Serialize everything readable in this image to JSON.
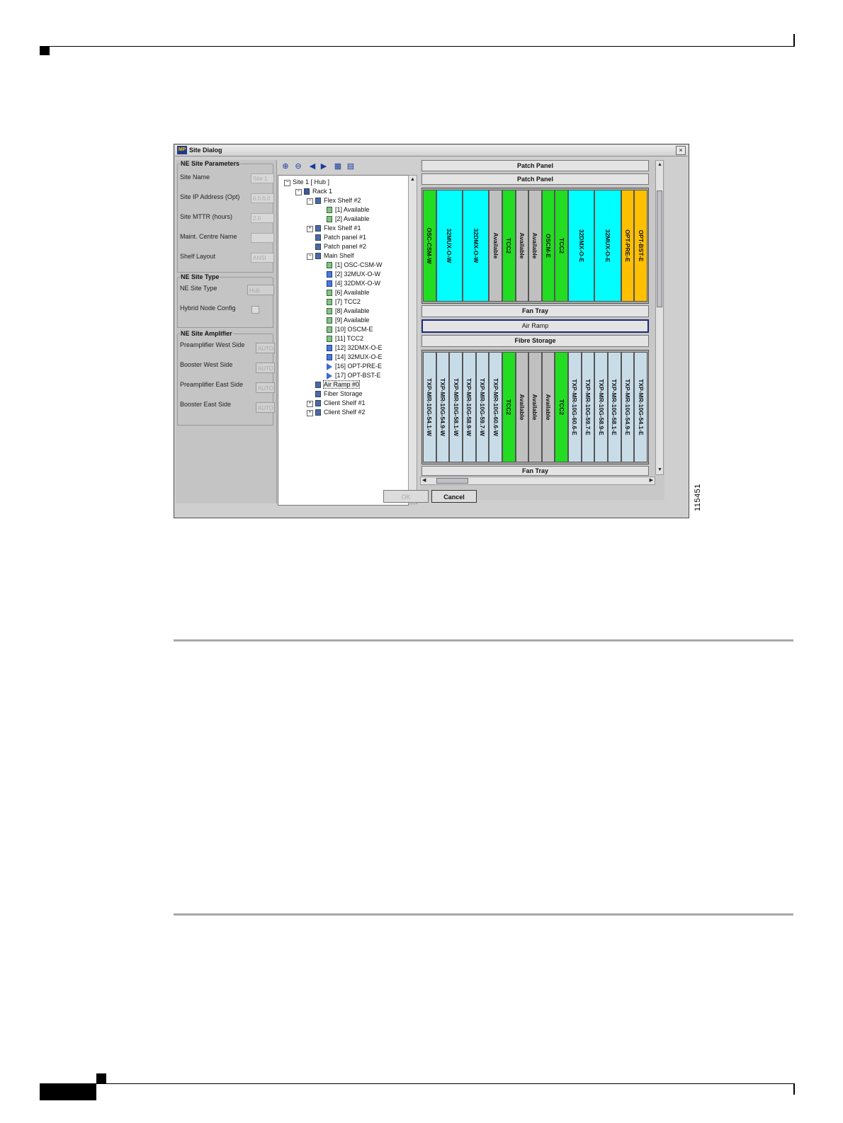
{
  "figure_id": "115451",
  "dialog": {
    "title": "Site Dialog",
    "close_label": "×",
    "left_panel": {
      "ne_site_parameters": {
        "title": "NE Site Parameters",
        "site_name_label": "Site Name",
        "site_name_value": "Site 1",
        "site_ip_label": "Site IP Address (Opt)",
        "site_ip_value": "0.0.0.0",
        "site_mttr_label": "Site MTTR (hours)",
        "site_mttr_value": "2.0",
        "maint_centre_label": "Maint. Centre Name",
        "maint_centre_value": "",
        "shelf_layout_label": "Shelf Layout",
        "shelf_layout_value": "ANSI"
      },
      "ne_site_type": {
        "title": "NE Site Type",
        "site_type_label": "NE Site Type",
        "site_type_value": "Hub",
        "hybrid_label": "Hybrid Node Config"
      },
      "ne_site_amplifier": {
        "title": "NE Site Amplifier",
        "pre_west_label": "Preamplifier West Side",
        "pre_west_value": "AUTO",
        "boost_west_label": "Booster West Side",
        "boost_west_value": "AUTO",
        "pre_east_label": "Preamplifier East Side",
        "pre_east_value": "AUTO",
        "boost_east_label": "Booster East Side",
        "boost_east_value": "AUTO"
      }
    },
    "tree": [
      {
        "label": "Site 1 [ Hub ]",
        "level": 0,
        "exp": "−",
        "icon": ""
      },
      {
        "label": "Rack 1",
        "level": 1,
        "exp": "−",
        "icon": "rack"
      },
      {
        "label": "Flex Shelf #2",
        "level": 2,
        "exp": "−",
        "icon": "shelf"
      },
      {
        "label": "[1] Available",
        "level": 3,
        "exp": "",
        "icon": "card"
      },
      {
        "label": "[2] Available",
        "level": 3,
        "exp": "",
        "icon": "card"
      },
      {
        "label": "Flex Shelf #1",
        "level": 2,
        "exp": "+",
        "icon": "shelf"
      },
      {
        "label": "Patch panel #1",
        "level": 2,
        "exp": "",
        "icon": "shelf"
      },
      {
        "label": "Patch panel #2",
        "level": 2,
        "exp": "",
        "icon": "shelf"
      },
      {
        "label": "Main Shelf",
        "level": 2,
        "exp": "−",
        "icon": "shelf"
      },
      {
        "label": "[1] OSC-CSM-W",
        "level": 3,
        "exp": "",
        "icon": "card"
      },
      {
        "label": "[2] 32MUX-O-W",
        "level": 3,
        "exp": "",
        "icon": "mux"
      },
      {
        "label": "[4] 32DMX-O-W",
        "level": 3,
        "exp": "",
        "icon": "mux"
      },
      {
        "label": "[6] Available",
        "level": 3,
        "exp": "",
        "icon": "card"
      },
      {
        "label": "[7] TCC2",
        "level": 3,
        "exp": "",
        "icon": "card"
      },
      {
        "label": "[8] Available",
        "level": 3,
        "exp": "",
        "icon": "card"
      },
      {
        "label": "[9] Available",
        "level": 3,
        "exp": "",
        "icon": "card"
      },
      {
        "label": "[10] OSCM-E",
        "level": 3,
        "exp": "",
        "icon": "card"
      },
      {
        "label": "[11] TCC2",
        "level": 3,
        "exp": "",
        "icon": "card"
      },
      {
        "label": "[12] 32DMX-O-E",
        "level": 3,
        "exp": "",
        "icon": "mux"
      },
      {
        "label": "[14] 32MUX-O-E",
        "level": 3,
        "exp": "",
        "icon": "mux"
      },
      {
        "label": "[16] OPT-PRE-E",
        "level": 3,
        "exp": "",
        "icon": "amp"
      },
      {
        "label": "[17] OPT-BST-E",
        "level": 3,
        "exp": "",
        "icon": "amp"
      },
      {
        "label": "Air Ramp #0",
        "level": 2,
        "exp": "",
        "icon": "shelf",
        "selected": true
      },
      {
        "label": "Fiber Storage",
        "level": 2,
        "exp": "",
        "icon": "shelf"
      },
      {
        "label": "Client Shelf #1",
        "level": 2,
        "exp": "+",
        "icon": "shelf"
      },
      {
        "label": "Client Shelf #2",
        "level": 2,
        "exp": "+",
        "icon": "shelf"
      }
    ],
    "rack": {
      "patch_panel_1": "Patch Panel",
      "patch_panel_2": "Patch Panel",
      "fan_tray_1": "Fan Tray",
      "air_ramp": "Air Ramp",
      "fibre_storage": "Fibre Storage",
      "fan_tray_2": "Fan Tray",
      "main_slots": [
        {
          "label": "OSC-CSM-W",
          "color": "#22dd22",
          "span": 1
        },
        {
          "label": "32MUX-O-W",
          "color": "#00ffff",
          "span": 2
        },
        {
          "label": "32DMX-O-W",
          "color": "#00ffff",
          "span": 2
        },
        {
          "label": "Available",
          "color": "#c0c0c0",
          "span": 1
        },
        {
          "label": "TCC2",
          "color": "#22dd22",
          "span": 1
        },
        {
          "label": "Available",
          "color": "#c0c0c0",
          "span": 1
        },
        {
          "label": "Available",
          "color": "#c0c0c0",
          "span": 1
        },
        {
          "label": "OSCM-E",
          "color": "#22dd22",
          "span": 1
        },
        {
          "label": "TCC2",
          "color": "#22dd22",
          "span": 1
        },
        {
          "label": "32DMX-O-E",
          "color": "#00ffff",
          "span": 2
        },
        {
          "label": "32MUX-O-E",
          "color": "#00ffff",
          "span": 2
        },
        {
          "label": "OPT-PRE-E",
          "color": "#ffc000",
          "span": 1
        },
        {
          "label": "OPT-BST-E",
          "color": "#ffc000",
          "span": 1
        }
      ],
      "client_slots": [
        {
          "label": "TXP-MR-10G-54.1-W",
          "color": "#c8dce8"
        },
        {
          "label": "TXP-MR-10G-54.9-W",
          "color": "#c8dce8"
        },
        {
          "label": "TXP-MR-10G-58.1-W",
          "color": "#c8dce8"
        },
        {
          "label": "TXP-MR-10G-58.9-W",
          "color": "#c8dce8"
        },
        {
          "label": "TXP-MR-10G-59.7-W",
          "color": "#c8dce8"
        },
        {
          "label": "TXP-MR-10G-60.6-W",
          "color": "#c8dce8"
        },
        {
          "label": "TCC2",
          "color": "#22dd22"
        },
        {
          "label": "Available",
          "color": "#c0c0c0"
        },
        {
          "label": "Available",
          "color": "#c0c0c0"
        },
        {
          "label": "Available",
          "color": "#c0c0c0"
        },
        {
          "label": "TCC2",
          "color": "#22dd22"
        },
        {
          "label": "TXP-MR-10G-60.6-E",
          "color": "#c8dce8"
        },
        {
          "label": "TXP-MR-10G-59.7-E",
          "color": "#c8dce8"
        },
        {
          "label": "TXP-MR-10G-58.9-E",
          "color": "#c8dce8"
        },
        {
          "label": "TXP-MR-10G-58.1-E",
          "color": "#c8dce8"
        },
        {
          "label": "TXP-MR-10G-54.9-E",
          "color": "#c8dce8"
        },
        {
          "label": "TXP-MR-10G-54.1-E",
          "color": "#c8dce8"
        }
      ]
    },
    "buttons": {
      "ok": "OK",
      "cancel": "Cancel"
    }
  }
}
